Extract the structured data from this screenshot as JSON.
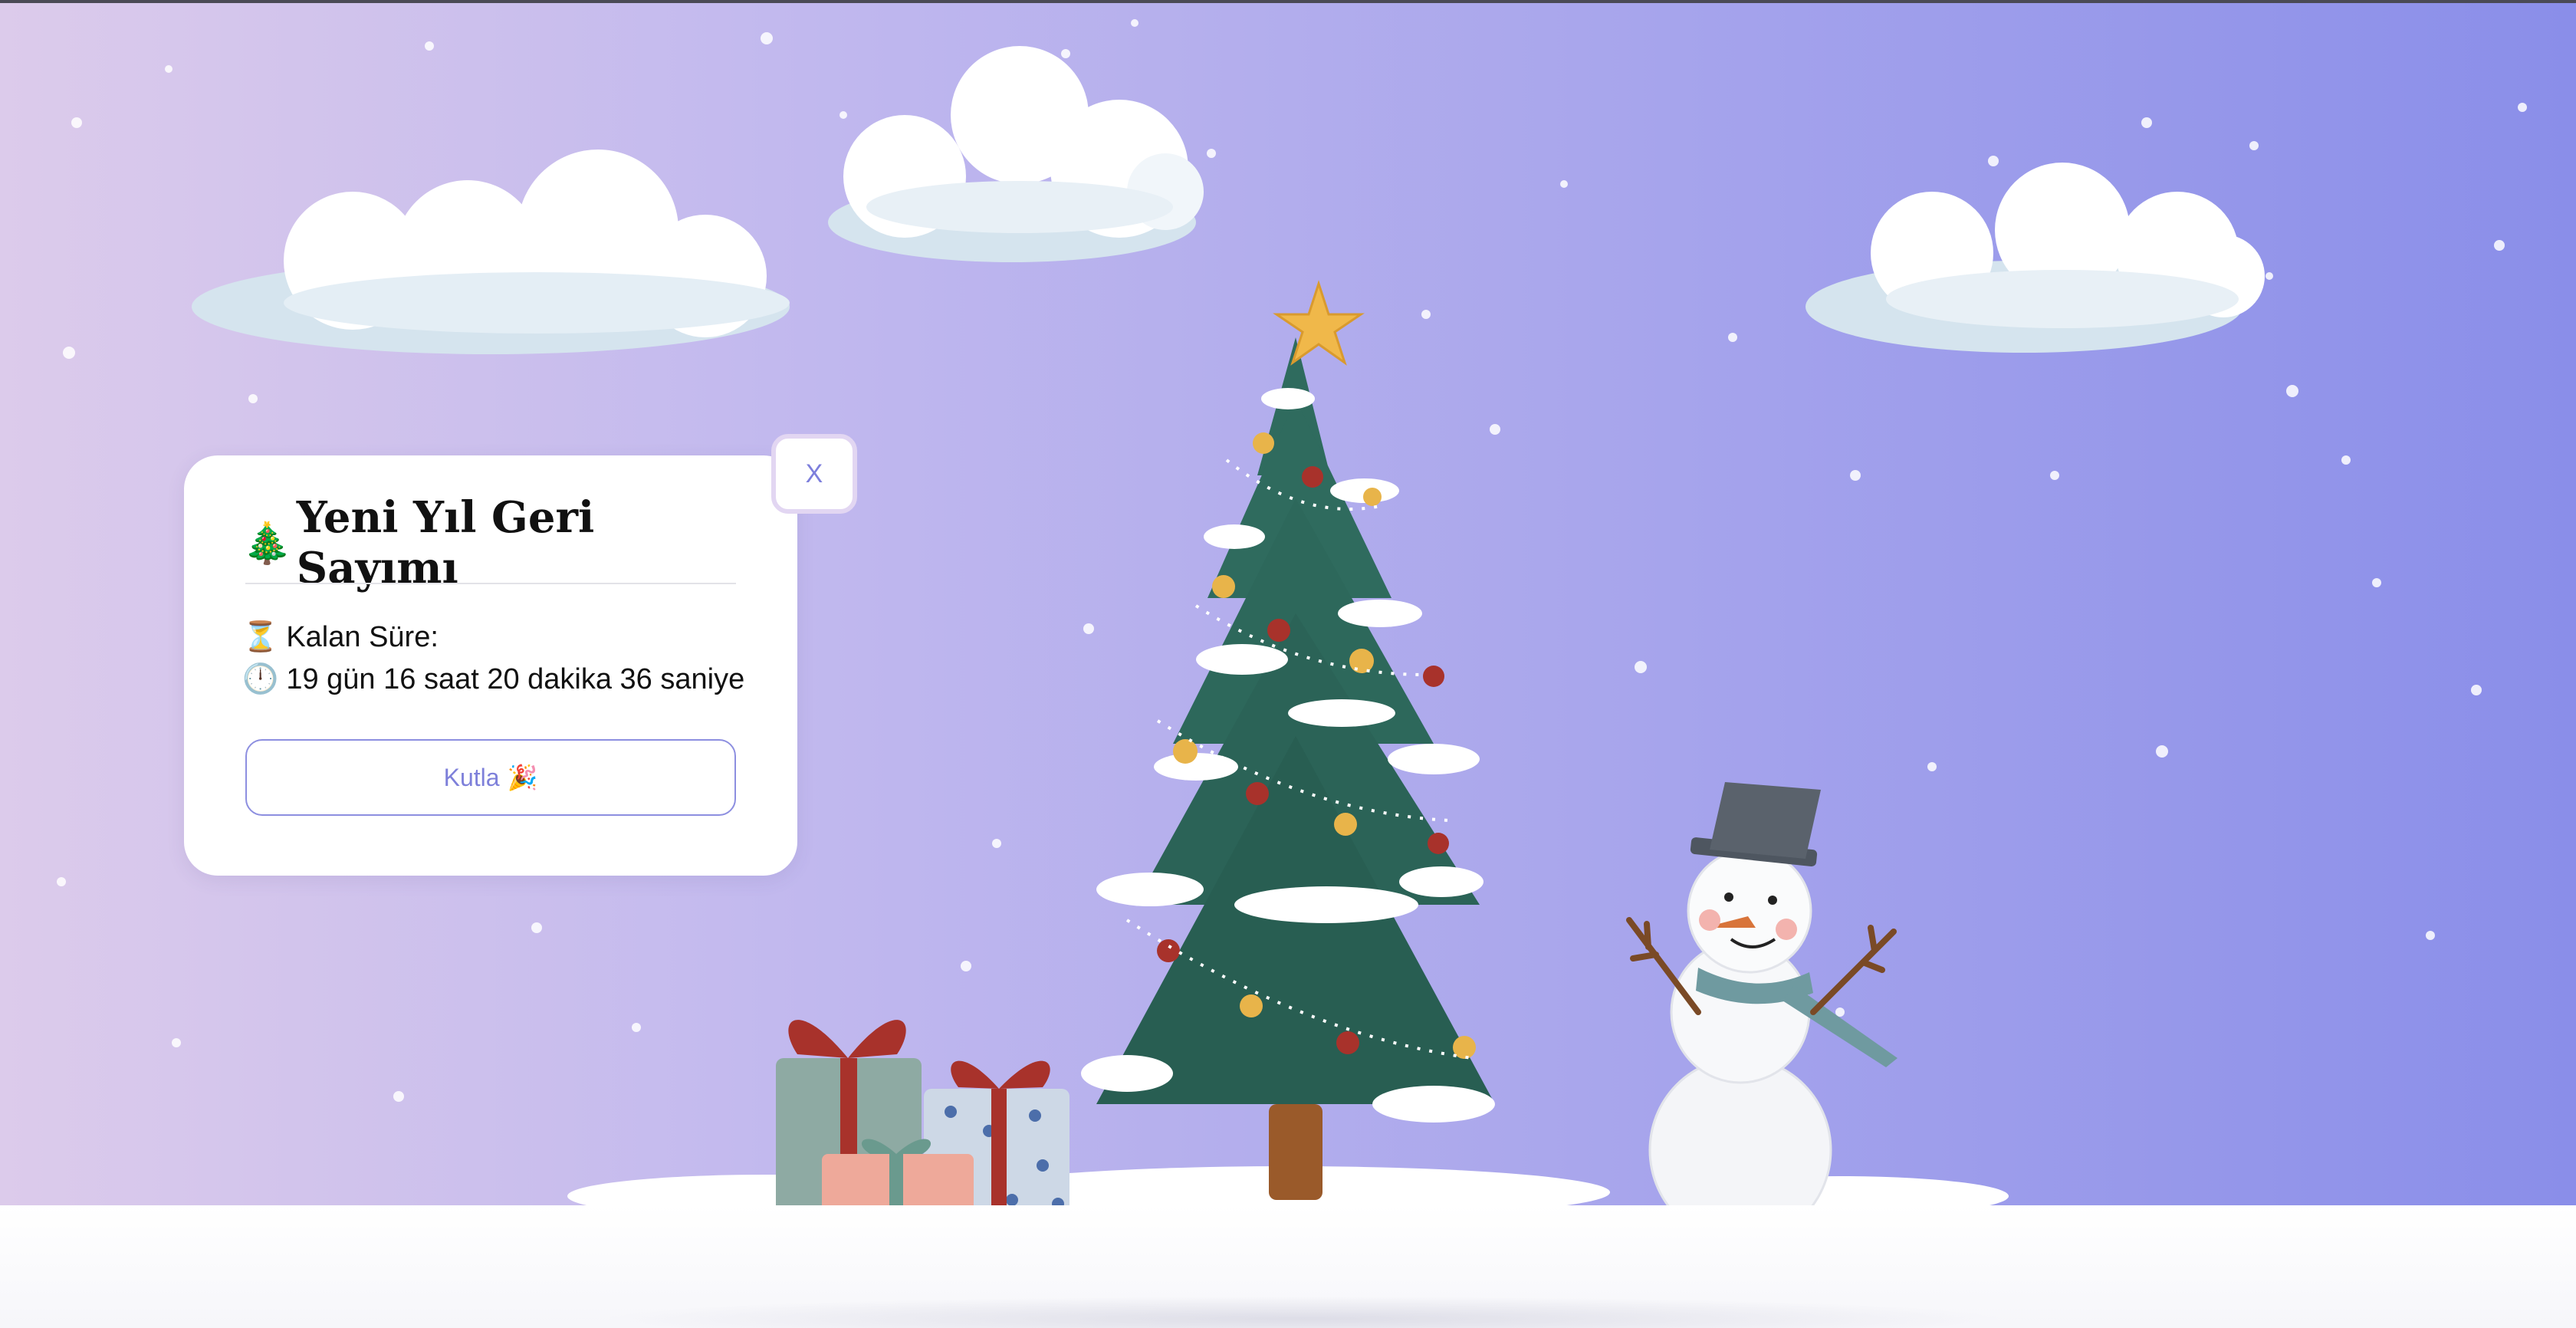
{
  "countdown": {
    "title": "Yeni Yıl Geri Sayımı",
    "title_icon": "🎄",
    "remaining_label": "Kalan Süre:",
    "remaining_icon": "⏳",
    "remaining_time": "19 gün 16 saat 20 dakika 36 saniye",
    "time_icon": "🕛",
    "celebrate_label": "Kutla",
    "celebrate_icon": "🎉",
    "close_label": "X"
  },
  "colors": {
    "accent": "#7e80da",
    "background_left": "#dccbeb",
    "background_right": "#8a8ee9",
    "tree": "#2f6b5e",
    "snow": "#ffffff"
  },
  "icons": [
    "christmas-tree-icon",
    "hourglass-icon",
    "clock-icon",
    "party-popper-icon",
    "close-icon"
  ]
}
